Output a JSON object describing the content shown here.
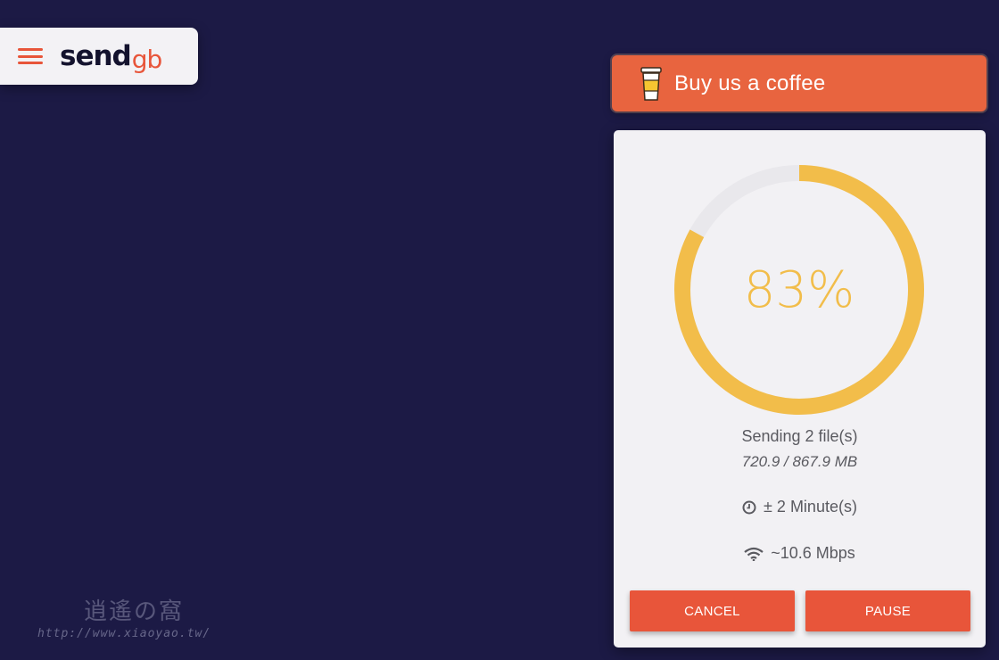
{
  "header": {
    "logo_text": "send",
    "logo_suffix": "gb",
    "menu_icon": "hamburger-menu-icon"
  },
  "coffee": {
    "label": "Buy us a coffee",
    "icon": "coffee-cup-icon",
    "color": "#e8643f"
  },
  "transfer": {
    "progress_percent": 83,
    "progress_label": "83%",
    "status": "Sending 2 file(s)",
    "size": "720.9 / 867.9 MB",
    "time_remaining": "± 2 Minute(s)",
    "time_icon": "clock-icon",
    "speed": "~10.6 Mbps",
    "speed_icon": "wifi-icon",
    "ring_color": "#f2bd4a",
    "track_color": "#e9e8ec"
  },
  "actions": {
    "cancel_label": "CANCEL",
    "pause_label": "PAUSE",
    "color": "#e8553a"
  },
  "watermark": {
    "title": "逍遙の窩",
    "url": "http://www.xiaoyao.tw/"
  }
}
